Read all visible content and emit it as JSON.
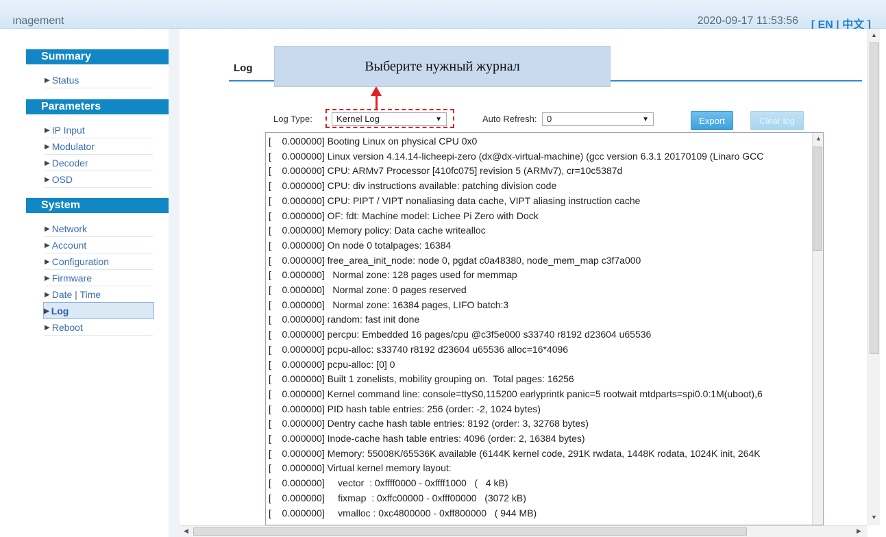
{
  "header": {
    "app_title": "ınagement",
    "datetime": "2020-09-17 11:53:56",
    "lang": "[ EN | 中文 ]"
  },
  "sidebar": {
    "summary": {
      "title": "Summary",
      "items": [
        "Status"
      ]
    },
    "parameters": {
      "title": "Parameters",
      "items": [
        "IP Input",
        "Modulator",
        "Decoder",
        "OSD"
      ]
    },
    "system": {
      "title": "System",
      "items": [
        "Network",
        "Account",
        "Configuration",
        "Firmware",
        "Date | Time",
        "Log",
        "Reboot"
      ]
    },
    "active": "Log"
  },
  "page": {
    "title": "Log",
    "callout": "Выберите нужный журнал"
  },
  "controls": {
    "log_type_label": "Log Type:",
    "log_type_value": "Kernel Log",
    "auto_refresh_label": "Auto Refresh:",
    "auto_refresh_value": "0",
    "export_label": "Export",
    "clear_label": "Clear log"
  },
  "log_lines": [
    "[    0.000000] Booting Linux on physical CPU 0x0",
    "[    0.000000] Linux version 4.14.14-licheepi-zero (dx@dx-virtual-machine) (gcc version 6.3.1 20170109 (Linaro GCC",
    "[    0.000000] CPU: ARMv7 Processor [410fc075] revision 5 (ARMv7), cr=10c5387d",
    "[    0.000000] CPU: div instructions available: patching division code",
    "[    0.000000] CPU: PIPT / VIPT nonaliasing data cache, VIPT aliasing instruction cache",
    "[    0.000000] OF: fdt: Machine model: Lichee Pi Zero with Dock",
    "[    0.000000] Memory policy: Data cache writealloc",
    "[    0.000000] On node 0 totalpages: 16384",
    "[    0.000000] free_area_init_node: node 0, pgdat c0a48380, node_mem_map c3f7a000",
    "[    0.000000]   Normal zone: 128 pages used for memmap",
    "[    0.000000]   Normal zone: 0 pages reserved",
    "[    0.000000]   Normal zone: 16384 pages, LIFO batch:3",
    "[    0.000000] random: fast init done",
    "[    0.000000] percpu: Embedded 16 pages/cpu @c3f5e000 s33740 r8192 d23604 u65536",
    "[    0.000000] pcpu-alloc: s33740 r8192 d23604 u65536 alloc=16*4096",
    "[    0.000000] pcpu-alloc: [0] 0",
    "[    0.000000] Built 1 zonelists, mobility grouping on.  Total pages: 16256",
    "[    0.000000] Kernel command line: console=ttyS0,115200 earlyprintk panic=5 rootwait mtdparts=spi0.0:1M(uboot),6",
    "[    0.000000] PID hash table entries: 256 (order: -2, 1024 bytes)",
    "[    0.000000] Dentry cache hash table entries: 8192 (order: 3, 32768 bytes)",
    "[    0.000000] Inode-cache hash table entries: 4096 (order: 2, 16384 bytes)",
    "[    0.000000] Memory: 55008K/65536K available (6144K kernel code, 291K rwdata, 1448K rodata, 1024K init, 264K",
    "[    0.000000] Virtual kernel memory layout:",
    "[    0.000000]     vector  : 0xffff0000 - 0xffff1000   (   4 kB)",
    "[    0.000000]     fixmap  : 0xffc00000 - 0xfff00000   (3072 kB)",
    "[    0.000000]     vmalloc : 0xc4800000 - 0xff800000   ( 944 MB)"
  ]
}
